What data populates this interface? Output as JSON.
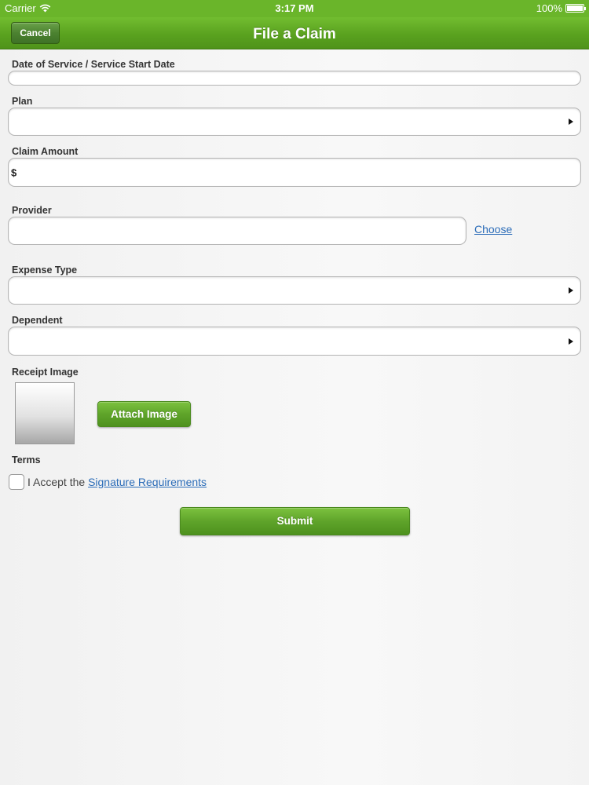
{
  "status_bar": {
    "carrier": "Carrier",
    "time": "3:17 PM",
    "battery": "100%",
    "battery_level": 1.0
  },
  "nav_bar": {
    "cancel_label": "Cancel",
    "title": "File a Claim"
  },
  "form": {
    "date_label": "Date of Service / Service Start Date",
    "date_value": "",
    "plan_label": "Plan",
    "plan_value": "",
    "amount_label": "Claim Amount",
    "amount_prefix": "$",
    "amount_value": "",
    "provider_label": "Provider",
    "provider_value": "",
    "provider_choose_link": "Choose",
    "expense_type_label": "Expense Type",
    "expense_type_value": "",
    "dependent_label": "Dependent",
    "dependent_value": "",
    "receipt_label": "Receipt Image",
    "attach_image_button": "Attach Image",
    "terms_label": "Terms",
    "terms_text": "I Accept the",
    "terms_link": "Signature Requirements",
    "terms_accepted": false,
    "submit_button": "Submit"
  },
  "colors": {
    "brand_green": "#5fa42a",
    "link_blue": "#2b6cb8"
  }
}
